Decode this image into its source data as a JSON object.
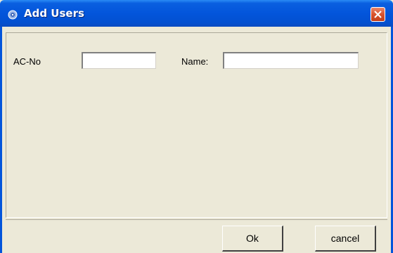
{
  "window": {
    "title": "Add Users"
  },
  "form": {
    "acno_label": "AC-No",
    "acno_value": "",
    "name_label": "Name:",
    "name_value": ""
  },
  "buttons": {
    "ok_label": "Ok",
    "cancel_label": "cancel"
  },
  "icons": {
    "app": "app-icon",
    "close": "close-icon"
  },
  "colors": {
    "titlebar": "#0355DB",
    "background": "#ECE9D8",
    "close_button": "#D8532E"
  }
}
